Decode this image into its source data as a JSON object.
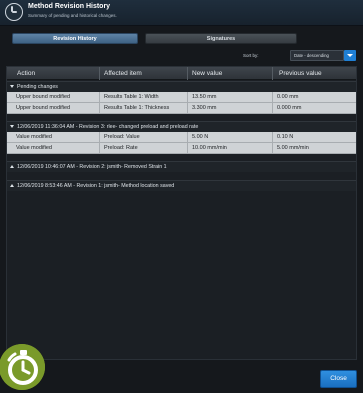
{
  "header": {
    "title": "Method Revision History",
    "subtitle": "Summary of pending and historical changes."
  },
  "tabs": [
    {
      "label": "Revision History",
      "active": true
    },
    {
      "label": "Signatures",
      "active": false
    }
  ],
  "sort": {
    "label": "Sort by:",
    "value": "Date - descending"
  },
  "table": {
    "columns": [
      "Action",
      "Affected item",
      "New value",
      "Previous value"
    ],
    "groups": [
      {
        "label": "Pending changes",
        "expanded": true,
        "rows": [
          [
            "Upper bound modified",
            "Results Table 1: Width",
            "13.50 mm",
            "0.00 mm"
          ],
          [
            "Upper bound modified",
            "Results Table 1: Thickness",
            "3.300 mm",
            "0.000 mm"
          ]
        ]
      },
      {
        "label": "12/06/2019 11:36:04 AM - Revision 3: rlee- changed preload and preload rate",
        "expanded": true,
        "rows": [
          [
            "Value modified",
            "Preload: Value",
            "5.00 N",
            "0.10 N"
          ],
          [
            "Value modified",
            "Preload: Rate",
            "10.00 mm/min",
            "5.00 mm/min"
          ]
        ]
      },
      {
        "label": "12/06/2019 10:46:07 AM - Revision 2: jsmith- Removed Strain 1",
        "expanded": false,
        "rows": []
      },
      {
        "label": "12/06/2019 8:53:46 AM - Revision 1: jsmith- Method location saved",
        "expanded": false,
        "rows": []
      }
    ]
  },
  "footer": {
    "close_label": "Close"
  },
  "colors": {
    "accent": "#1f7fd4",
    "active_tab": "#4e7396",
    "logo_green": "#7a9a2a"
  },
  "icons": {
    "header": "stopwatch-icon",
    "logo": "stopwatch-icon"
  }
}
